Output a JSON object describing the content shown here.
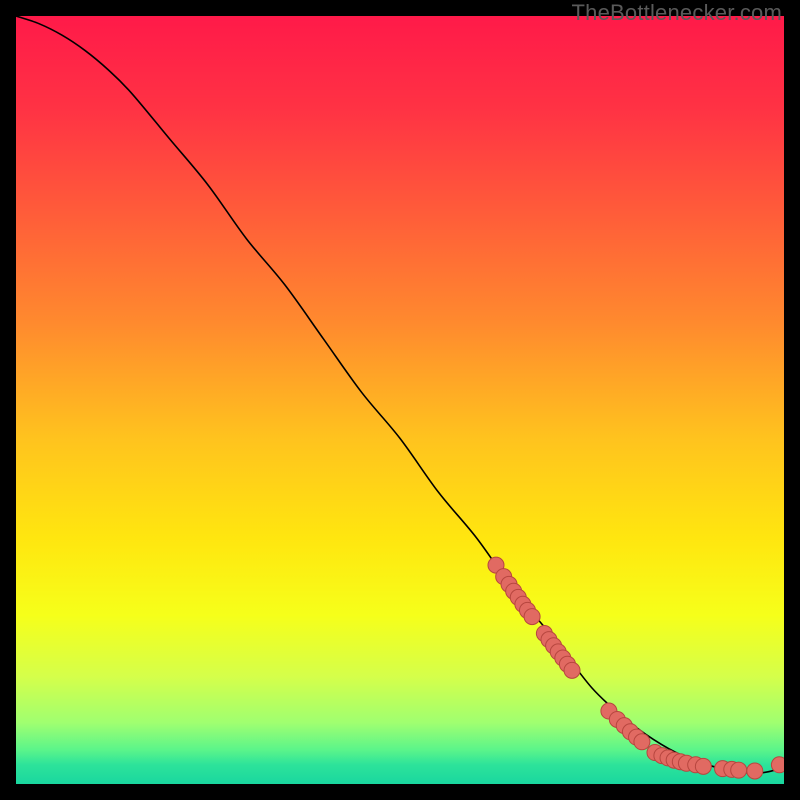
{
  "watermark": "TheBottlenecker.com",
  "gradient": {
    "stops": [
      {
        "offset": 0.0,
        "color": "#ff1a49"
      },
      {
        "offset": 0.12,
        "color": "#ff3244"
      },
      {
        "offset": 0.25,
        "color": "#ff5a3a"
      },
      {
        "offset": 0.4,
        "color": "#ff8a2e"
      },
      {
        "offset": 0.55,
        "color": "#ffc31e"
      },
      {
        "offset": 0.68,
        "color": "#ffe60f"
      },
      {
        "offset": 0.78,
        "color": "#f6ff1a"
      },
      {
        "offset": 0.86,
        "color": "#d5ff4a"
      },
      {
        "offset": 0.92,
        "color": "#a0ff70"
      },
      {
        "offset": 0.955,
        "color": "#5cf58a"
      },
      {
        "offset": 0.975,
        "color": "#2de39a"
      },
      {
        "offset": 1.0,
        "color": "#19d79f"
      }
    ]
  },
  "chart_data": {
    "type": "line",
    "title": "",
    "xlabel": "",
    "ylabel": "",
    "xlim": [
      0,
      100
    ],
    "ylim": [
      0,
      100
    ],
    "series": [
      {
        "name": "curve",
        "x": [
          0,
          3,
          6,
          9,
          12,
          15,
          20,
          25,
          30,
          35,
          40,
          45,
          50,
          55,
          60,
          65,
          70,
          73,
          75,
          77,
          79,
          81,
          83,
          85,
          87,
          90,
          93,
          96,
          98,
          100
        ],
        "y": [
          100,
          99,
          97.5,
          95.5,
          93,
          90,
          84,
          78,
          71,
          65,
          58,
          51,
          45,
          38,
          32,
          25,
          19,
          15,
          12.5,
          10.5,
          8.8,
          7.2,
          5.8,
          4.6,
          3.6,
          2.5,
          1.8,
          1.4,
          1.6,
          2.2
        ]
      }
    ],
    "marker_clusters": [
      {
        "name": "cluster-upper",
        "points": [
          {
            "x": 62.5,
            "y": 28.5
          },
          {
            "x": 63.5,
            "y": 27.0
          },
          {
            "x": 64.2,
            "y": 26.0
          },
          {
            "x": 64.8,
            "y": 25.1
          },
          {
            "x": 65.4,
            "y": 24.3
          },
          {
            "x": 66.0,
            "y": 23.4
          },
          {
            "x": 66.6,
            "y": 22.6
          },
          {
            "x": 67.2,
            "y": 21.8
          },
          {
            "x": 68.8,
            "y": 19.6
          },
          {
            "x": 69.4,
            "y": 18.8
          },
          {
            "x": 70.0,
            "y": 18.0
          },
          {
            "x": 70.6,
            "y": 17.2
          },
          {
            "x": 71.2,
            "y": 16.4
          },
          {
            "x": 71.8,
            "y": 15.6
          },
          {
            "x": 72.4,
            "y": 14.8
          }
        ]
      },
      {
        "name": "cluster-bend",
        "points": [
          {
            "x": 77.2,
            "y": 9.5
          },
          {
            "x": 78.3,
            "y": 8.4
          },
          {
            "x": 79.2,
            "y": 7.6
          },
          {
            "x": 80.0,
            "y": 6.8
          },
          {
            "x": 80.8,
            "y": 6.1
          },
          {
            "x": 81.5,
            "y": 5.5
          }
        ]
      },
      {
        "name": "cluster-flat",
        "points": [
          {
            "x": 83.2,
            "y": 4.1
          },
          {
            "x": 84.1,
            "y": 3.7
          },
          {
            "x": 84.9,
            "y": 3.4
          },
          {
            "x": 85.7,
            "y": 3.1
          },
          {
            "x": 86.5,
            "y": 2.9
          },
          {
            "x": 87.3,
            "y": 2.7
          },
          {
            "x": 88.5,
            "y": 2.5
          },
          {
            "x": 89.5,
            "y": 2.3
          },
          {
            "x": 92.0,
            "y": 2.0
          },
          {
            "x": 93.2,
            "y": 1.9
          },
          {
            "x": 94.1,
            "y": 1.8
          },
          {
            "x": 96.2,
            "y": 1.7
          },
          {
            "x": 99.4,
            "y": 2.5
          }
        ]
      }
    ],
    "marker_style": {
      "radius": 8,
      "fill": "#e16a62",
      "stroke": "#b7463f",
      "stroke_width": 1
    },
    "line_style": {
      "stroke": "#000000",
      "width": 1.6
    }
  }
}
